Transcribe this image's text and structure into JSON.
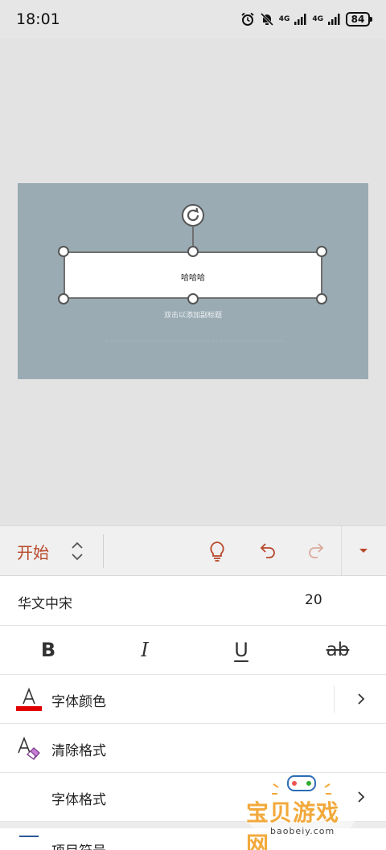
{
  "status_bar": {
    "time": "18:01",
    "network_1": "4G",
    "network_2": "4G",
    "battery": "84"
  },
  "slide": {
    "title_text": "哈哈哈",
    "subtitle_placeholder": "双击以添加副标题",
    "background_color": "#9aabb3"
  },
  "toolbar": {
    "tab_label": "开始",
    "accent_color": "#b7472a",
    "icons": [
      "tab-switch-icon",
      "lightbulb-icon",
      "undo-icon",
      "redo-icon",
      "expand-ribbon-icon"
    ]
  },
  "panel": {
    "font_name": "华文中宋",
    "font_size": "20",
    "format_buttons": {
      "bold": "B",
      "italic": "I",
      "underline": "U",
      "strikethrough": "ab"
    },
    "items": {
      "font_color": "字体颜色",
      "clear_format": "清除格式",
      "font_format": "字体格式",
      "bullets": "项目符号"
    },
    "font_color_swatch": "#e00000"
  },
  "watermark": {
    "text": "宝贝游戏网",
    "url": "baobeiy.com"
  }
}
